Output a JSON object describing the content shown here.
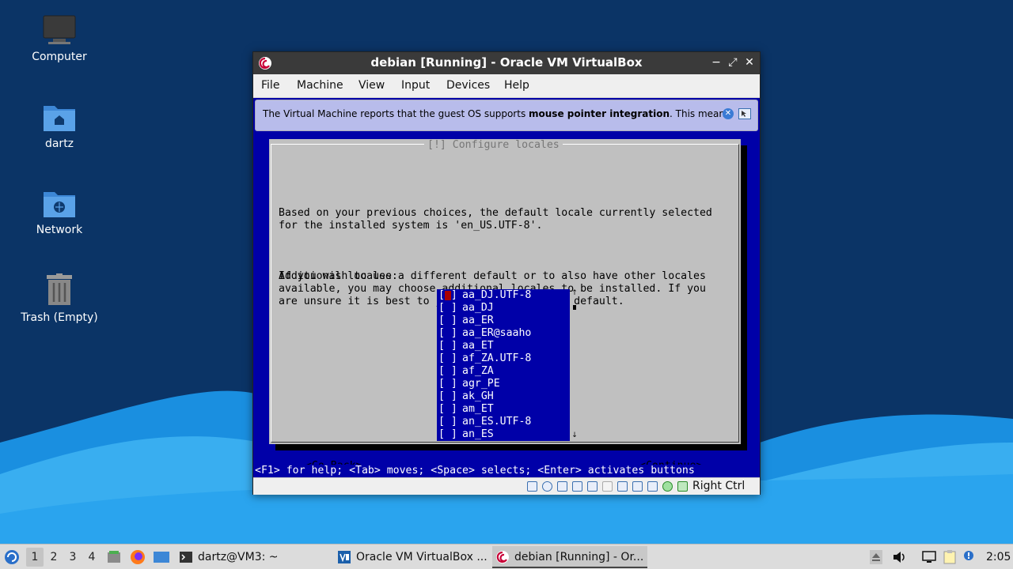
{
  "desktop": {
    "icons": [
      {
        "label": "Computer"
      },
      {
        "label": "dartz"
      },
      {
        "label": "Network"
      },
      {
        "label": "Trash (Empty)"
      }
    ]
  },
  "window": {
    "title": "debian [Running] - Oracle VM VirtualBox",
    "controls": {
      "minimize": "−",
      "maximize": "⤢",
      "close": "✕"
    },
    "menu": [
      "File",
      "Machine",
      "View",
      "Input",
      "Devices",
      "Help"
    ],
    "banner": {
      "prefix": "The Virtual Machine reports that the guest OS supports ",
      "bold": "mouse pointer integration",
      "suffix": ". This means"
    },
    "status_bar": {
      "host_key": "Right Ctrl"
    }
  },
  "installer": {
    "dialog_title": "[!] Configure locales",
    "paragraph1": "Based on your previous choices, the default locale currently selected\nfor the installed system is 'en_US.UTF-8'.",
    "paragraph2": "If you wish to use a different default or to also have other locales\navailable, you may choose additional locales to be installed. If you\nare unsure it is best to just use the selected default.",
    "list_label": "Additional locales:",
    "locales": [
      {
        "box": "[ ]",
        "name": "aa_DJ.UTF-8"
      },
      {
        "box": "[ ]",
        "name": "aa_DJ"
      },
      {
        "box": "[ ]",
        "name": "aa_ER"
      },
      {
        "box": "[ ]",
        "name": "aa_ER@saaho"
      },
      {
        "box": "[ ]",
        "name": "aa_ET"
      },
      {
        "box": "[ ]",
        "name": "af_ZA.UTF-8"
      },
      {
        "box": "[ ]",
        "name": "af_ZA"
      },
      {
        "box": "[ ]",
        "name": "agr_PE"
      },
      {
        "box": "[ ]",
        "name": "ak_GH"
      },
      {
        "box": "[ ]",
        "name": "am_ET"
      },
      {
        "box": "[ ]",
        "name": "an_ES.UTF-8"
      },
      {
        "box": "[ ]",
        "name": "an_ES"
      }
    ],
    "scroll_up": "↑",
    "scroll_down": "↓",
    "go_back": "<Go Back>",
    "continue": "<Continue>",
    "help_line": "<F1> for help; <Tab> moves; <Space> selects; <Enter> activates buttons"
  },
  "taskbar": {
    "workspaces": [
      "1",
      "2",
      "3",
      "4"
    ],
    "active_workspace": "1",
    "tasks": [
      {
        "label": "dartz@VM3: ~"
      },
      {
        "label": "Oracle VM VirtualBox ..."
      },
      {
        "label": "debian [Running] - Or..."
      }
    ],
    "clock": "2:05"
  },
  "colors": {
    "vm_background": "#0000a8",
    "dialog": "#c0c0c0",
    "list_cursor": "#a80000",
    "wallpaper": "#0b3466"
  }
}
